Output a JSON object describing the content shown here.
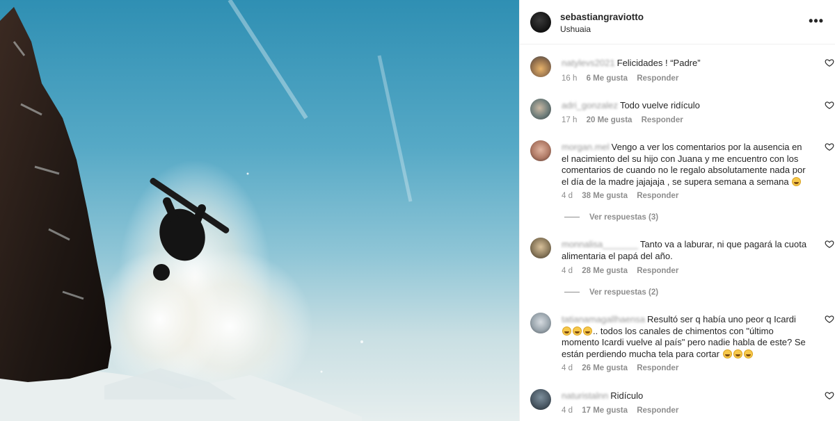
{
  "post": {
    "username": "sebastiangraviotto",
    "location": "Ushuaia",
    "more_label": "•••"
  },
  "colors": {
    "accent_text": "#262626",
    "muted_text": "#8e8e8e",
    "sky": "#56a9c6"
  },
  "comments": [
    {
      "username": "natylevs2021",
      "text": "Felicidades ! “Padre”",
      "emoji_count": 0,
      "time": "16 h",
      "likes": "6 Me gusta",
      "reply": "Responder",
      "avatar_color": "#c7a070"
    },
    {
      "username": "adri_gonzalez",
      "text": "Todo vuelve ridículo",
      "emoji_count": 0,
      "time": "17 h",
      "likes": "20 Me gusta",
      "reply": "Responder",
      "avatar_color": "#6f7d7a"
    },
    {
      "username": "morgan.mel",
      "text": "Vengo a ver los comentarios por la ausencia en el nacimiento del su hijo con Juana y me encuentro con los comentarios de cuando no le regalo absolutamente nada por el día de la madre jajajaja , se supera semana a semana",
      "emoji_count": 1,
      "time": "4 d",
      "likes": "38 Me gusta",
      "reply": "Responder",
      "view_replies": "Ver respuestas (3)",
      "avatar_color": "#b07a66"
    },
    {
      "username": "monnalisa_______",
      "text": "Tanto va a laburar, ni que pagará la cuota alimentaria el papá del año.",
      "emoji_count": 0,
      "time": "4 d",
      "likes": "28 Me gusta",
      "reply": "Responder",
      "view_replies": "Ver respuestas (2)",
      "avatar_color": "#8b7a5c"
    },
    {
      "username": "tatianamagallhaensa",
      "text_a": "Resultó ser q había uno peor q Icardi",
      "text_b": ".. todos los canales de chimentos con \"último momento Icardi vuelve al país\" pero nadie habla de este? Se están perdiendo mucha tela para cortar",
      "time": "4 d",
      "likes": "26 Me gusta",
      "reply": "Responder",
      "avatar_color": "#9aa5ad"
    },
    {
      "username": "naturistalnn",
      "text": "Ridículo",
      "emoji_count": 0,
      "time": "4 d",
      "likes": "17 Me gusta",
      "reply": "Responder",
      "avatar_color": "#4c5a66"
    }
  ]
}
